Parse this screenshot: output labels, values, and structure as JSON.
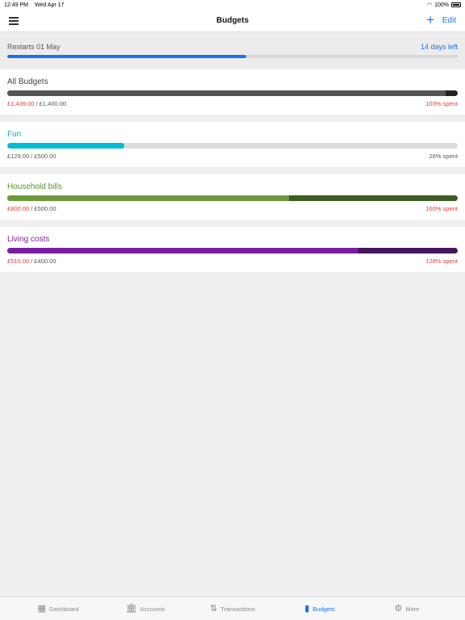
{
  "status": {
    "time": "12:49 PM",
    "date": "Wed Apr 17",
    "battery": "100%"
  },
  "nav": {
    "title": "Budgets",
    "add_icon": "+",
    "edit_label": "Edit"
  },
  "restart": {
    "label": "Restarts 01 May",
    "days_left": "14 days left",
    "progress_fraction": 0.53
  },
  "budgets": [
    {
      "name": "All Budgets",
      "spent": "£1,439.00",
      "total": "£1,400.00",
      "percent": "103% spent",
      "fraction": 1.0,
      "over_fraction": 0.027,
      "color": "#555555",
      "over_color": "#222222",
      "title_color": "#444444",
      "over": true
    },
    {
      "name": "Fun",
      "spent": "£129.00",
      "total": "£500.00",
      "percent": "26% spent",
      "fraction": 0.26,
      "over_fraction": 0,
      "color": "#00bcd4",
      "over_color": "#00bcd4",
      "title_color": "#00acc1",
      "over": false
    },
    {
      "name": "Household bills",
      "spent": "£800.00",
      "total": "£500.00",
      "percent": "160% spent",
      "fraction": 1.0,
      "over_fraction": 0.375,
      "color": "#6a9a3a",
      "over_color": "#3f5d22",
      "title_color": "#5a8f2a",
      "over": true
    },
    {
      "name": "Living costs",
      "spent": "£510.00",
      "total": "£400.00",
      "percent": "128% spent",
      "fraction": 1.0,
      "over_fraction": 0.22,
      "color": "#7b1fa2",
      "over_color": "#45175a",
      "title_color": "#7b1fa2",
      "over": true
    }
  ],
  "tabs": [
    {
      "label": "Dashboard",
      "icon": "dashboard-icon",
      "glyph": "▦",
      "active": false
    },
    {
      "label": "Accounts",
      "icon": "bank-icon",
      "glyph": "🏛",
      "active": false
    },
    {
      "label": "Transactions",
      "icon": "transactions-icon",
      "glyph": "⇅",
      "active": false
    },
    {
      "label": "Budgets",
      "icon": "budgets-icon",
      "glyph": "▮",
      "active": true
    },
    {
      "label": "More",
      "icon": "more-icon",
      "glyph": "⚙",
      "active": false
    }
  ]
}
